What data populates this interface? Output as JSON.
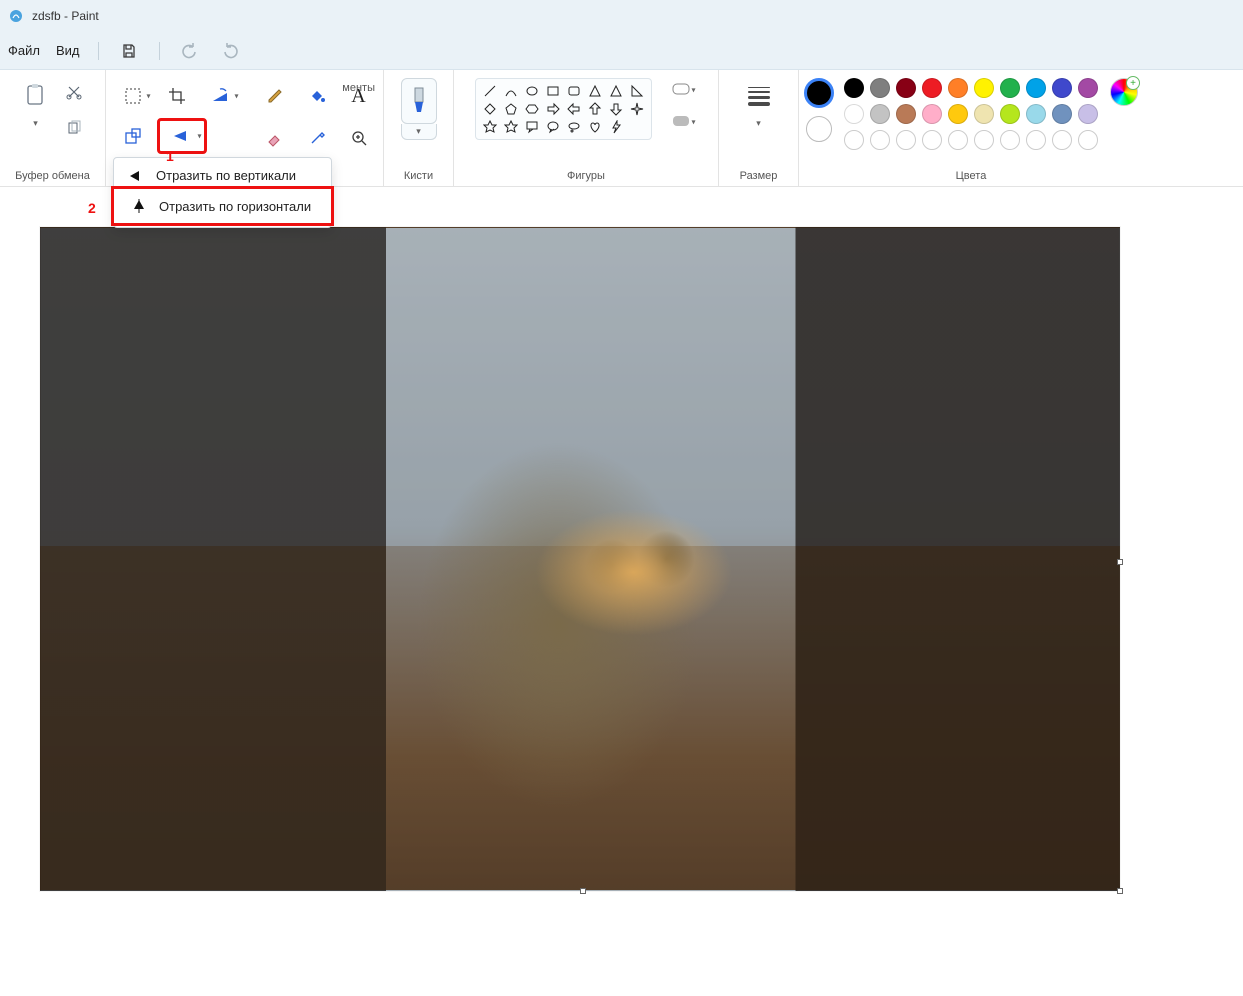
{
  "titlebar": {
    "title": "zdsfb - Paint"
  },
  "menubar": {
    "file": "Файл",
    "view": "Вид"
  },
  "groups": {
    "clipboard": "Буфер обмена",
    "image": "менты",
    "tools_hidden": "",
    "brushes": "Кисти",
    "shapes": "Фигуры",
    "size": "Размер",
    "colors": "Цвета"
  },
  "flip_menu": {
    "vert": "Отразить по вертикали",
    "horiz": "Отразить по горизонтали"
  },
  "callouts": {
    "one": "1",
    "two": "2"
  },
  "palette_colors": [
    "#000000",
    "#7f7f7f",
    "#880015",
    "#ed1c24",
    "#ff7f27",
    "#fff200",
    "#22b14c",
    "#00a2e8",
    "#3f48cc",
    "#a349a4",
    "#ffffff",
    "#c3c3c3",
    "#b97a57",
    "#ffaec9",
    "#ffc90e",
    "#efe4b0",
    "#b5e61d",
    "#99d9ea",
    "#7092be",
    "#c8bfe7"
  ],
  "active_color1": "#000000",
  "active_color2": "#ffffff"
}
